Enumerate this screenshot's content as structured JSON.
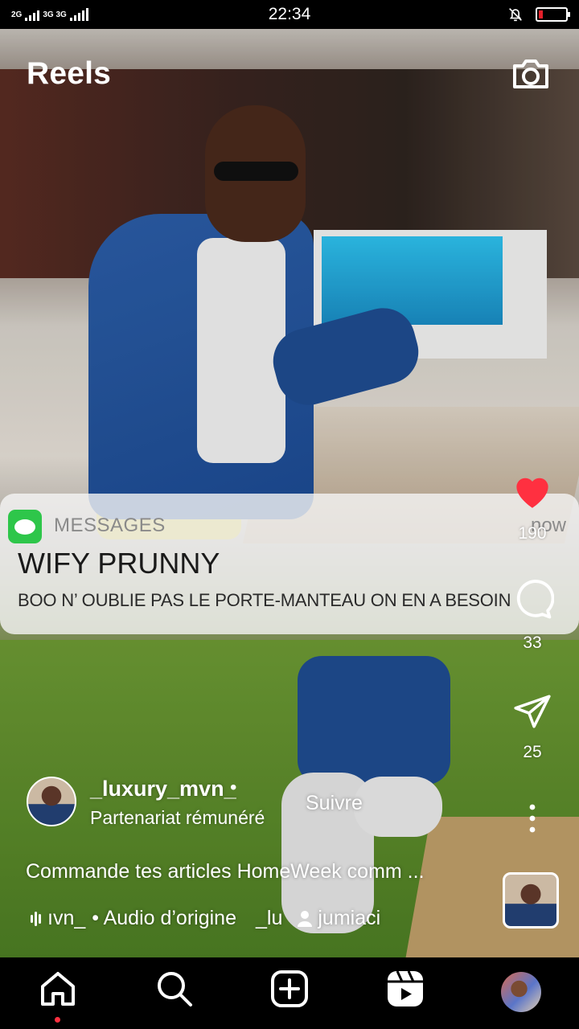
{
  "status_bar": {
    "network_1": "2G",
    "network_2": "3G 3G",
    "time": "22:34",
    "icons": [
      "signal-icon",
      "bell-muted-icon",
      "battery-icon"
    ],
    "battery_level": 0.15,
    "battery_color": "#e5202a"
  },
  "header": {
    "title": "Reels",
    "camera_icon": "camera-icon"
  },
  "notification": {
    "app_name": "MESSAGES",
    "time": "now",
    "sender": "WIFY PRUNNY",
    "message": "BOO N’   OUBLIE PAS LE PORTE-MANTEAU ON EN A BESOIN",
    "app_color": "#2ec64a"
  },
  "actions": {
    "likes": "190",
    "comments": "33",
    "shares": "25",
    "like_color": "#ff3040"
  },
  "post": {
    "username": "_luxury_mvn_",
    "separator": "•",
    "partnership": "Partenariat rémunéré",
    "follow_label": "Suivre",
    "caption": "Commande tes articles HomeWeek comm ...",
    "audio_user_fragment": "ıvn_",
    "audio_label": "• Audio d’origine",
    "audio_user_fragment_2": "_lu",
    "tagged_user": "jumiaci"
  },
  "nav": {
    "items": [
      "home-icon",
      "search-icon",
      "create-icon",
      "reels-icon",
      "profile-avatar"
    ],
    "active": "home-icon",
    "active_dot_color": "#ff3040"
  }
}
